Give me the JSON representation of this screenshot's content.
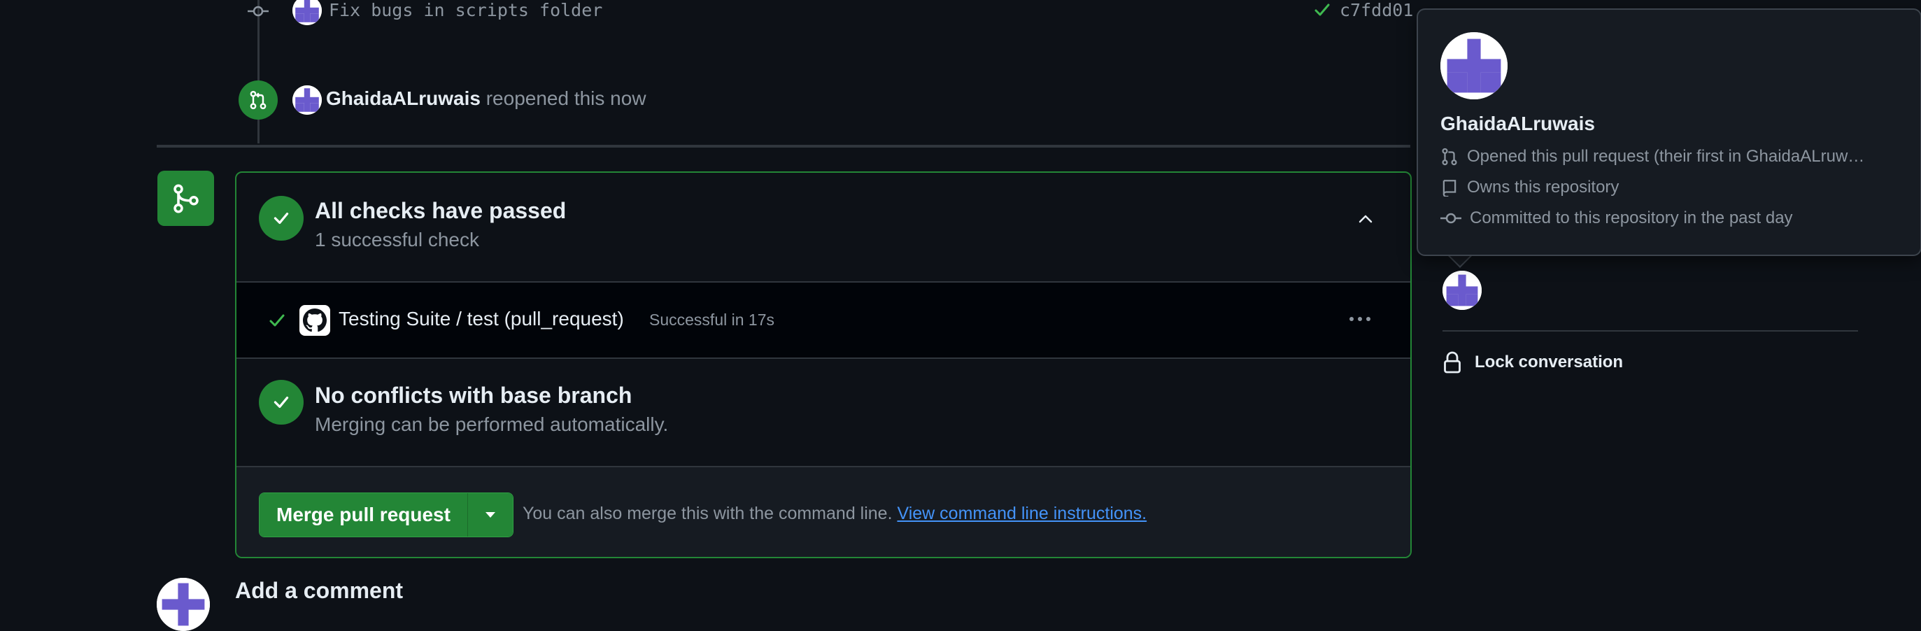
{
  "timeline": {
    "commit": {
      "message": "Fix bugs in scripts folder",
      "sha": "c7fdd01"
    },
    "event": {
      "user": "GhaidaALruwais",
      "action": "reopened this now"
    }
  },
  "merge_box": {
    "checks": {
      "title": "All checks have passed",
      "subtitle": "1 successful check"
    },
    "check_item": {
      "name": "Testing Suite / test (pull_request)",
      "status": "Successful in 17s"
    },
    "conflicts": {
      "title": "No conflicts with base branch",
      "subtitle": "Merging can be performed automatically."
    },
    "merge": {
      "button_label": "Merge pull request",
      "hint": "You can also merge this with the command line.",
      "link": "View command line instructions."
    }
  },
  "comment": {
    "title": "Add a comment"
  },
  "popover": {
    "name": "GhaidaALruwais",
    "rows": [
      "Opened this pull request (their first in GhaidaALruw…",
      "Owns this repository",
      "Committed to this repository in the past day"
    ]
  },
  "sidebar": {
    "lock_label": "Lock conversation"
  },
  "colors": {
    "success": "#238636",
    "link": "#4493f8",
    "bg": "#0d1117"
  }
}
